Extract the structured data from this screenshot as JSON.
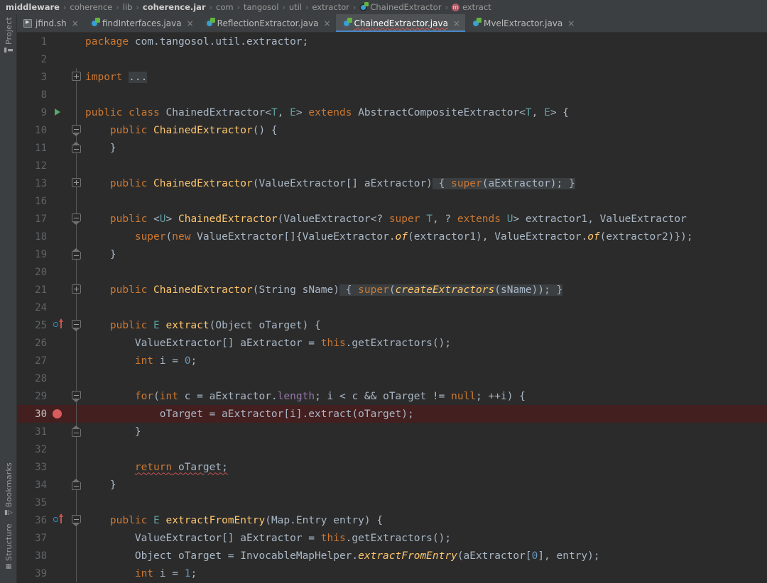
{
  "breadcrumb": {
    "items": [
      {
        "label": "middleware",
        "style": "bold",
        "icon": null
      },
      {
        "label": "coherence",
        "style": "dim",
        "icon": null
      },
      {
        "label": "lib",
        "style": "dim",
        "icon": null
      },
      {
        "label": "coherence.jar",
        "style": "bold",
        "icon": null
      },
      {
        "label": "com",
        "style": "dim",
        "icon": null
      },
      {
        "label": "tangosol",
        "style": "dim",
        "icon": null
      },
      {
        "label": "util",
        "style": "dim",
        "icon": null
      },
      {
        "label": "extractor",
        "style": "dim",
        "icon": null
      },
      {
        "label": "ChainedExtractor",
        "style": "dim",
        "icon": "class-icon"
      },
      {
        "label": "extract",
        "style": "dim",
        "icon": "method-icon"
      }
    ],
    "separator": "›"
  },
  "tabs": [
    {
      "label": "jfind.sh",
      "icon": "shell-script-icon",
      "active": false,
      "close": "×"
    },
    {
      "label": "findInterfaces.java",
      "icon": "java-class-icon",
      "active": false,
      "close": "×"
    },
    {
      "label": "ReflectionExtractor.java",
      "icon": "java-class-icon",
      "active": false,
      "close": "×"
    },
    {
      "label": "ChainedExtractor.java",
      "icon": "java-class-icon",
      "active": true,
      "close": "×"
    },
    {
      "label": "MvelExtractor.java",
      "icon": "java-class-icon",
      "active": false,
      "close": "×"
    }
  ],
  "left_tool_strip": [
    {
      "label": "Project",
      "icon": "folder-icon"
    },
    {
      "label": "Bookmarks",
      "icon": "bookmark-icon"
    },
    {
      "label": "Structure",
      "icon": "structure-icon"
    }
  ],
  "editor": {
    "file": "ChainedExtractor.java",
    "language": "java",
    "lines": [
      {
        "num": "1",
        "mark": null,
        "fold": null,
        "highlight": false
      },
      {
        "num": "2",
        "mark": null,
        "fold": null,
        "highlight": false
      },
      {
        "num": "3",
        "mark": null,
        "fold": "plus",
        "highlight": false
      },
      {
        "num": "8",
        "mark": null,
        "fold": null,
        "highlight": false
      },
      {
        "num": "9",
        "mark": "run",
        "fold": null,
        "highlight": false
      },
      {
        "num": "10",
        "mark": null,
        "fold": "down",
        "highlight": false
      },
      {
        "num": "11",
        "mark": null,
        "fold": "up",
        "highlight": false
      },
      {
        "num": "12",
        "mark": null,
        "fold": null,
        "highlight": false
      },
      {
        "num": "13",
        "mark": null,
        "fold": "plus",
        "highlight": false
      },
      {
        "num": "16",
        "mark": null,
        "fold": null,
        "highlight": false
      },
      {
        "num": "17",
        "mark": null,
        "fold": "down",
        "highlight": false
      },
      {
        "num": "18",
        "mark": null,
        "fold": null,
        "highlight": false
      },
      {
        "num": "19",
        "mark": null,
        "fold": "up",
        "highlight": false
      },
      {
        "num": "20",
        "mark": null,
        "fold": null,
        "highlight": false
      },
      {
        "num": "21",
        "mark": null,
        "fold": "plus",
        "highlight": false
      },
      {
        "num": "24",
        "mark": null,
        "fold": null,
        "highlight": false
      },
      {
        "num": "25",
        "mark": "override",
        "fold": "down",
        "highlight": false
      },
      {
        "num": "26",
        "mark": null,
        "fold": null,
        "highlight": false
      },
      {
        "num": "27",
        "mark": null,
        "fold": null,
        "highlight": false
      },
      {
        "num": "28",
        "mark": null,
        "fold": null,
        "highlight": false
      },
      {
        "num": "29",
        "mark": null,
        "fold": "down",
        "highlight": false
      },
      {
        "num": "30",
        "mark": "breakpoint",
        "fold": null,
        "highlight": true
      },
      {
        "num": "31",
        "mark": null,
        "fold": "up",
        "highlight": false
      },
      {
        "num": "32",
        "mark": null,
        "fold": null,
        "highlight": false
      },
      {
        "num": "33",
        "mark": null,
        "fold": null,
        "highlight": false
      },
      {
        "num": "34",
        "mark": null,
        "fold": "up",
        "highlight": false
      },
      {
        "num": "35",
        "mark": null,
        "fold": null,
        "highlight": false
      },
      {
        "num": "36",
        "mark": "override",
        "fold": "down",
        "highlight": false
      },
      {
        "num": "37",
        "mark": null,
        "fold": null,
        "highlight": false
      },
      {
        "num": "38",
        "mark": null,
        "fold": null,
        "highlight": false
      },
      {
        "num": "39",
        "mark": null,
        "fold": null,
        "highlight": false
      }
    ],
    "source_text": [
      "package com.tangosol.util.extractor;",
      "",
      "import ...",
      "",
      "public class ChainedExtractor<T, E> extends AbstractCompositeExtractor<T, E> {",
      "    public ChainedExtractor() {",
      "    }",
      "",
      "    public ChainedExtractor(ValueExtractor[] aExtractor) { super(aExtractor); }",
      "",
      "    public <U> ChainedExtractor(ValueExtractor<? super T, ? extends U> extractor1, ValueExtractor",
      "        super(new ValueExtractor[]{ValueExtractor.of(extractor1), ValueExtractor.of(extractor2)});",
      "    }",
      "",
      "    public ChainedExtractor(String sName) { super(createExtractors(sName)); }",
      "",
      "    public E extract(Object oTarget) {",
      "        ValueExtractor[] aExtractor = this.getExtractors();",
      "        int i = 0;",
      "",
      "        for(int c = aExtractor.length; i < c && oTarget != null; ++i) {",
      "            oTarget = aExtractor[i].extract(oTarget);",
      "        }",
      "",
      "        return oTarget;",
      "    }",
      "",
      "    public E extractFromEntry(Map.Entry entry) {",
      "        ValueExtractor[] aExtractor = this.getExtractors();",
      "        Object oTarget = InvocableMapHelper.extractFromEntry(aExtractor[0], entry);",
      "        int i = 1;"
    ]
  },
  "colors": {
    "editor_background": "#2b2b2b",
    "chrome_background": "#3c3f41",
    "active_tab_background": "#4e5254",
    "active_tab_underline": "#4a88c7",
    "keyword": "#cc7832",
    "method": "#ffc66d",
    "field": "#9876aa",
    "number": "#6897bb",
    "generic_type": "#5f9e9d",
    "plain_text": "#a9b7c6",
    "line_number": "#606366",
    "breakpoint": "#db5c5c",
    "breakpoint_line_highlight": "#441f1f",
    "run_marker": "#59a869",
    "error_squiggle": "#c75450"
  }
}
